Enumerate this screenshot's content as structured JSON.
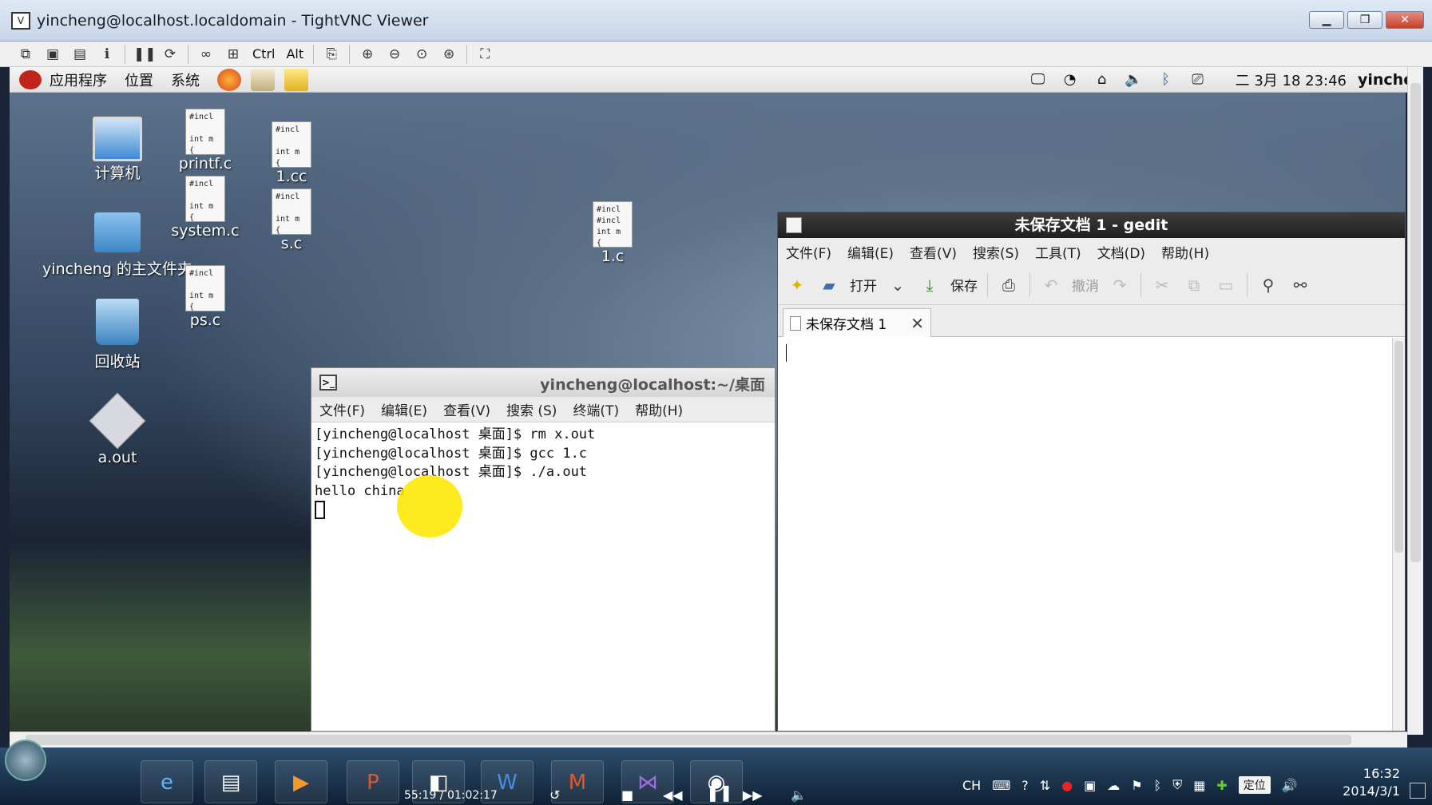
{
  "vnc": {
    "title": "yincheng@localhost.localdomain - TightVNC Viewer",
    "minimize": "▁",
    "maximize": "❐",
    "close": "✕",
    "toolbar": {
      "ctrl": "Ctrl",
      "alt": "Alt"
    }
  },
  "panel": {
    "apps": "应用程序",
    "places": "位置",
    "system": "系统",
    "clock": "二 3月 18 23:46",
    "user": "yincheng"
  },
  "desktop": {
    "icons": {
      "computer": "计算机",
      "home": "yincheng 的主文件夹",
      "trash": "回收站",
      "aout": "a.out",
      "printf": "printf.c",
      "system": "system.c",
      "ps": "ps.c",
      "onecc": "1.cc",
      "sc": "s.c",
      "onec": "1.c"
    },
    "file_preview": "#incl\n\nint m\n{",
    "file_preview_2": "#incl\n#incl\nint m\n{"
  },
  "terminal": {
    "title": "yincheng@localhost:~/桌面",
    "menu": [
      "文件(F)",
      "编辑(E)",
      "查看(V)",
      "搜索 (S)",
      "终端(T)",
      "帮助(H)"
    ],
    "lines": [
      "[yincheng@localhost 桌面]$ rm x.out",
      "[yincheng@localhost 桌面]$ gcc 1.c",
      "[yincheng@localhost 桌面]$ ./a.out",
      "hello china"
    ]
  },
  "gedit": {
    "title": "未保存文档 1 - gedit",
    "menu": [
      "文件(F)",
      "编辑(E)",
      "查看(V)",
      "搜索(S)",
      "工具(T)",
      "文档(D)",
      "帮助(H)"
    ],
    "toolbar": {
      "open": "打开",
      "save": "保存",
      "undo": "撤消"
    },
    "tab": "未保存文档 1"
  },
  "taskbar": {
    "media_time": "55:19 / 01:02:17",
    "ime": "CH",
    "location": "定位",
    "time": "16:32",
    "date": "2014/3/1"
  },
  "colors": {
    "gedit_title": "#2a2a2a",
    "desktop_sky": "#5c718b",
    "highlight": "#ffe600"
  }
}
